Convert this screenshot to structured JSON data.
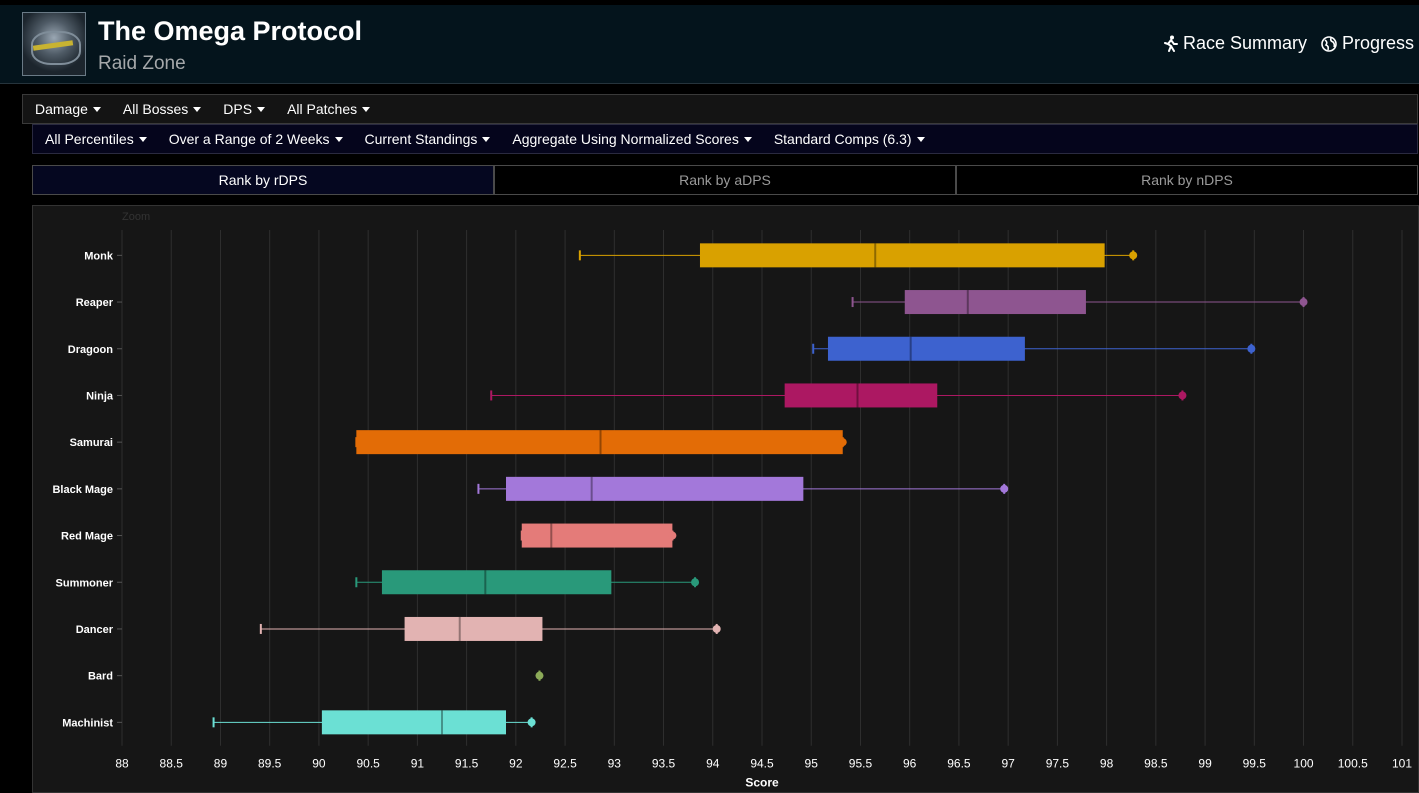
{
  "header": {
    "title": "The Omega Protocol",
    "subtitle": "Raid Zone",
    "links": [
      {
        "label": "Race Summary",
        "icon": "running-person-icon"
      },
      {
        "label": "Progress",
        "icon": "globe-icon"
      }
    ]
  },
  "filters_primary": [
    "Damage",
    "All Bosses",
    "DPS",
    "All Patches"
  ],
  "filters_secondary": [
    "All Percentiles",
    "Over a Range of 2 Weeks",
    "Current Standings",
    "Aggregate Using Normalized Scores",
    "Standard Comps (6.3)"
  ],
  "tabs": [
    {
      "label": "Rank by rDPS",
      "active": true
    },
    {
      "label": "Rank by aDPS",
      "active": false
    },
    {
      "label": "Rank by nDPS",
      "active": false
    }
  ],
  "zoom_label": "Zoom",
  "chart_data": {
    "type": "boxplot",
    "orientation": "horizontal",
    "xlabel": "Score",
    "xlim": [
      88,
      101
    ],
    "xticks": [
      "88",
      "88.5",
      "89",
      "89.5",
      "90",
      "90.5",
      "91",
      "91.5",
      "92",
      "92.5",
      "93",
      "93.5",
      "94",
      "94.5",
      "95",
      "95.5",
      "96",
      "96.5",
      "97",
      "97.5",
      "98",
      "98.5",
      "99",
      "99.5",
      "100",
      "100.5",
      "101"
    ],
    "grid": true,
    "series": [
      {
        "name": "Monk",
        "color": "#d9a100",
        "min": 92.65,
        "q1": 93.87,
        "median": 95.65,
        "q3": 97.98,
        "max": 98.27,
        "point": 98.27
      },
      {
        "name": "Reaper",
        "color": "#8e5590",
        "min": 95.42,
        "q1": 95.95,
        "median": 96.59,
        "q3": 97.79,
        "max": 100.0,
        "point": 100.0
      },
      {
        "name": "Dragoon",
        "color": "#3d62cf",
        "min": 95.02,
        "q1": 95.17,
        "median": 96.01,
        "q3": 97.17,
        "max": 99.47,
        "point": 99.47
      },
      {
        "name": "Ninja",
        "color": "#ac1862",
        "min": 91.75,
        "q1": 94.73,
        "median": 95.47,
        "q3": 96.28,
        "max": 98.77,
        "point": 98.77
      },
      {
        "name": "Samurai",
        "color": "#e36c06",
        "min": 90.38,
        "q1": 90.38,
        "median": 92.86,
        "q3": 95.32,
        "max": 95.32,
        "point": 95.32
      },
      {
        "name": "Black Mage",
        "color": "#a378da",
        "min": 91.62,
        "q1": 91.9,
        "median": 92.77,
        "q3": 94.92,
        "max": 96.96,
        "point": 96.96
      },
      {
        "name": "Red Mage",
        "color": "#e47b79",
        "min": 92.06,
        "q1": 92.06,
        "median": 92.36,
        "q3": 93.59,
        "max": 93.59,
        "point": 93.59
      },
      {
        "name": "Summoner",
        "color": "#29997a",
        "min": 90.38,
        "q1": 90.64,
        "median": 91.69,
        "q3": 92.97,
        "max": 93.82,
        "point": 93.82
      },
      {
        "name": "Dancer",
        "color": "#e2b3b2",
        "min": 89.41,
        "q1": 90.87,
        "median": 91.43,
        "q3": 92.27,
        "max": 94.04,
        "point": 94.04
      },
      {
        "name": "Bard",
        "color": "#8caa58",
        "min": 92.24,
        "q1": 92.24,
        "median": 92.24,
        "q3": 92.24,
        "max": 92.24,
        "point": 92.24
      },
      {
        "name": "Machinist",
        "color": "#6be0d4",
        "min": 88.93,
        "q1": 90.03,
        "median": 91.25,
        "q3": 91.9,
        "max": 92.16,
        "point": 92.16
      }
    ]
  }
}
